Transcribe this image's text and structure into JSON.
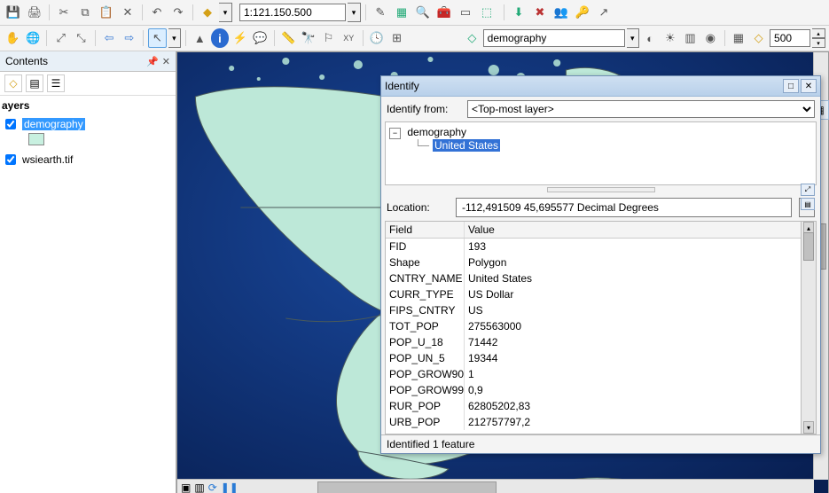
{
  "toolbar1": {
    "scale": "1:121.150.500"
  },
  "toolbar2": {
    "layer_dropdown": "demography",
    "search_radius": "500"
  },
  "contents": {
    "title": "Contents",
    "layers_header": "ayers",
    "layer1": "demography",
    "layer2": "wsiearth.tif"
  },
  "identify": {
    "title": "Identify",
    "from_label": "Identify from:",
    "from_value": "<Top-most layer>",
    "tree_root": "demography",
    "tree_leaf": "United States",
    "location_label": "Location:",
    "location_value": "-112,491509  45,695577 Decimal Degrees",
    "header_field": "Field",
    "header_value": "Value",
    "attributes": [
      {
        "field": "FID",
        "value": "193"
      },
      {
        "field": "Shape",
        "value": "Polygon"
      },
      {
        "field": "CNTRY_NAME",
        "value": "United States"
      },
      {
        "field": "CURR_TYPE",
        "value": "US Dollar"
      },
      {
        "field": "FIPS_CNTRY",
        "value": "US"
      },
      {
        "field": "TOT_POP",
        "value": "275563000"
      },
      {
        "field": "POP_U_18",
        "value": "71442"
      },
      {
        "field": "POP_UN_5",
        "value": "19344"
      },
      {
        "field": "POP_GROW90",
        "value": "1"
      },
      {
        "field": "POP_GROW99",
        "value": "0,9"
      },
      {
        "field": "RUR_POP",
        "value": "62805202,83"
      },
      {
        "field": "URB_POP",
        "value": "212757797,2"
      }
    ],
    "status": "Identified 1 feature"
  }
}
